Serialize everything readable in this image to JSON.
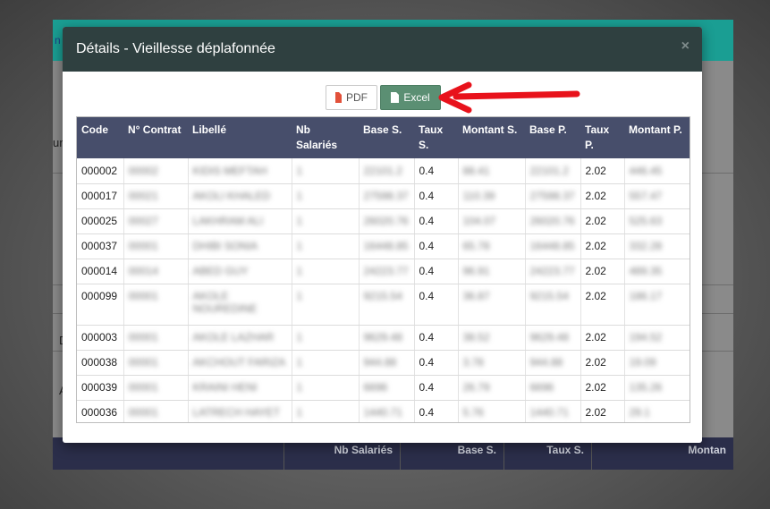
{
  "background": {
    "link_fragment": "n",
    "text_fragments": [
      "ur",
      "D",
      "A"
    ],
    "table_headers": [
      "Nb Salariés",
      "Base S.",
      "Taux S.",
      "Montan"
    ]
  },
  "modal": {
    "title": "Détails - Vieillesse déplafonnée",
    "close": "×",
    "buttons": {
      "pdf": "PDF",
      "excel": "Excel"
    },
    "table": {
      "headers": [
        "Code",
        "N° Contrat",
        "Libellé",
        "Nb Salariés",
        "Base S.",
        "Taux S.",
        "Montant S.",
        "Base P.",
        "Taux P.",
        "Montant P."
      ],
      "rows": [
        [
          "000002",
          "00002",
          "KIDIS MEFTAH",
          "1",
          "22101.2",
          "0.4",
          "88.41",
          "22101.2",
          "2.02",
          "446.45"
        ],
        [
          "000017",
          "00021",
          "AKOLI KHALED",
          "1",
          "27598.37",
          "0.4",
          "110.39",
          "27598.37",
          "2.02",
          "557.47"
        ],
        [
          "000025",
          "00027",
          "LAKHRAM ALI",
          "1",
          "26020.76",
          "0.4",
          "104.07",
          "26020.76",
          "2.02",
          "525.63"
        ],
        [
          "000037",
          "00001",
          "DHIBI SONIA",
          "1",
          "16448.85",
          "0.4",
          "65.78",
          "16448.85",
          "2.02",
          "332.28"
        ],
        [
          "000014",
          "00014",
          "ABED GUY",
          "1",
          "24223.77",
          "0.4",
          "96.91",
          "24223.77",
          "2.02",
          "489.35"
        ],
        [
          "000099",
          "00001",
          "AKOLE NOUREDINE",
          "1",
          "9215.54",
          "0.4",
          "36.87",
          "9215.54",
          "2.02",
          "186.17"
        ],
        [
          "000003",
          "00001",
          "AKOLE LAZHAR",
          "1",
          "9629.48",
          "0.4",
          "38.52",
          "9629.48",
          "2.02",
          "194.52"
        ],
        [
          "000038",
          "00001",
          "AKCHOUT FARIZA",
          "1",
          "944.88",
          "0.4",
          "3.78",
          "944.88",
          "2.02",
          "19.09"
        ],
        [
          "000039",
          "00001",
          "KRAINI HENI",
          "1",
          "6696",
          "0.4",
          "26.79",
          "6696",
          "2.02",
          "135.26"
        ],
        [
          "000036",
          "00001",
          "LATRECH HAYET",
          "1",
          "1440.71",
          "0.4",
          "5.76",
          "1440.71",
          "2.02",
          "29.1"
        ]
      ]
    }
  },
  "colors": {
    "modal_header": "#2f4040",
    "table_header": "#474e6b",
    "excel_button": "#5b8f73",
    "annotation_arrow": "#e8121b",
    "top_bar": "#1a9e93"
  }
}
